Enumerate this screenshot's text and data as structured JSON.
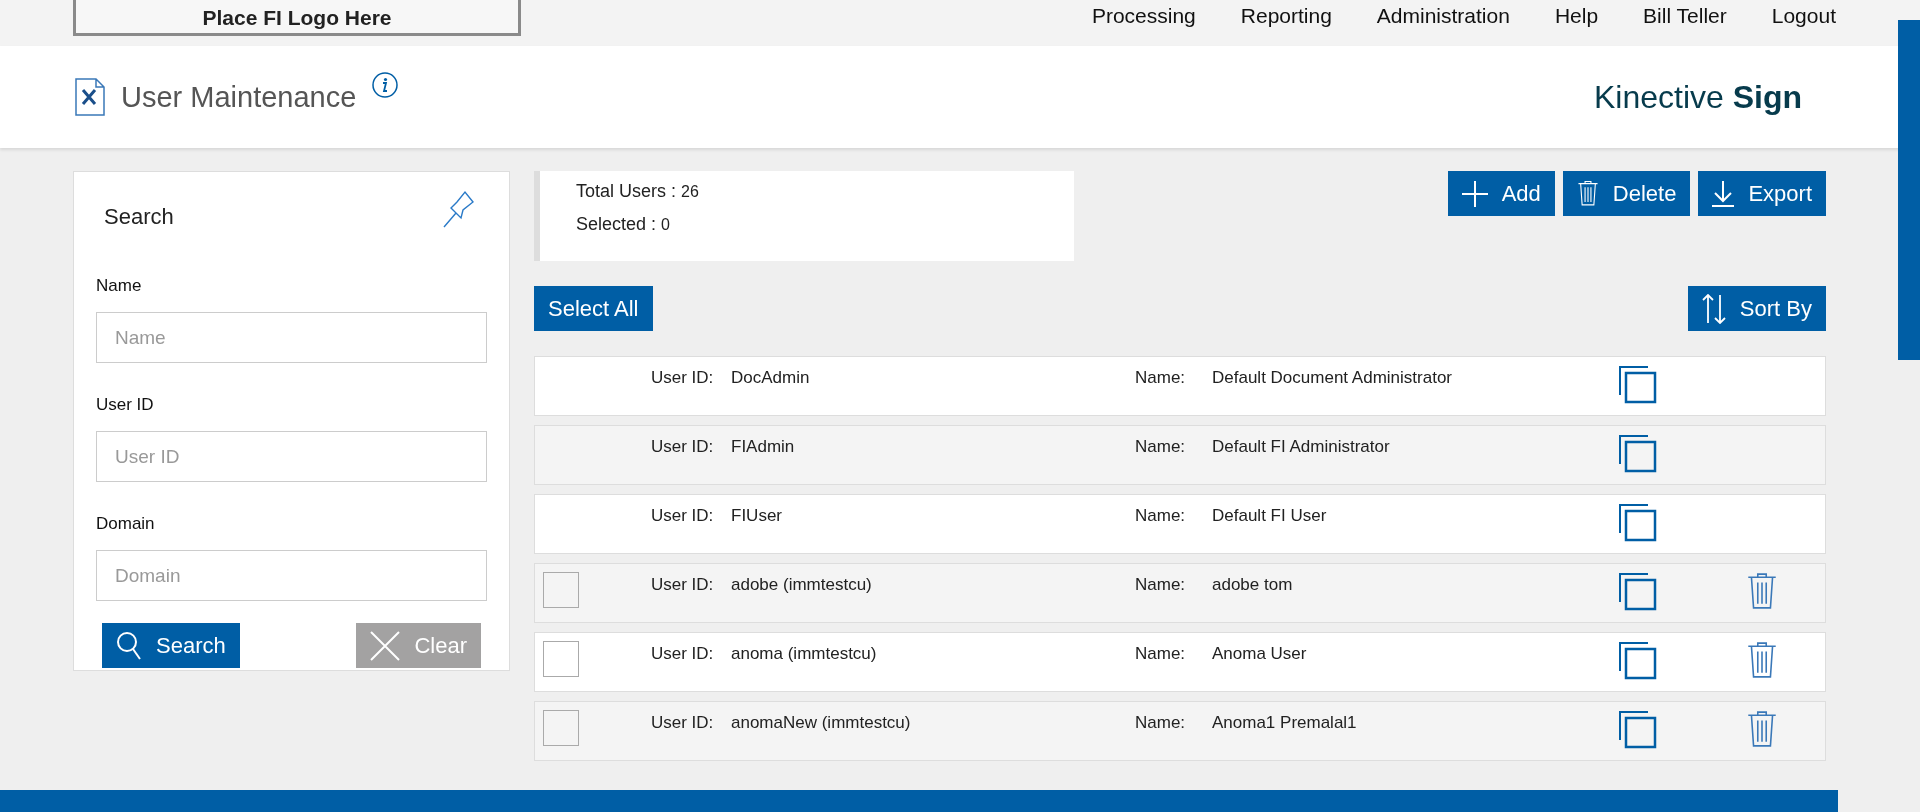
{
  "header": {
    "logo": "Place FI Logo Here",
    "nav": [
      "Processing",
      "Reporting",
      "Administration",
      "Help",
      "Bill Teller",
      "Logout"
    ]
  },
  "page": {
    "title": "User Maintenance",
    "brand": "Kinective **Sign**"
  },
  "search_panel": {
    "title": "Search",
    "fields": [
      {
        "label": "Name",
        "placeholder": "Name"
      },
      {
        "label": "User ID",
        "placeholder": "User ID"
      },
      {
        "label": "Domain",
        "placeholder": "Domain"
      }
    ],
    "buttons": [
      {
        "kind": "search",
        "label": "Search"
      },
      {
        "kind": "clear",
        "label": "Clear"
      }
    ]
  },
  "summary": [
    {
      "label": "Total Users :",
      "value": "26"
    },
    {
      "label": "Selected :",
      "value": "0"
    }
  ],
  "actions": [
    {
      "kind": "add",
      "label": "Add"
    },
    {
      "kind": "delete",
      "label": "Delete"
    },
    {
      "kind": "export",
      "label": "Export"
    }
  ],
  "select_all": "Select All",
  "sort": "Sort By",
  "rows": [
    {
      "kind": "system",
      "user_id_label": "User ID:",
      "user_id": "DocAdmin",
      "name_label": "Name:",
      "name": "Default Document Administrator"
    },
    {
      "kind": "system",
      "user_id_label": "User ID:",
      "user_id": "FIAdmin",
      "name_label": "Name:",
      "name": "Default FI Administrator"
    },
    {
      "kind": "system",
      "user_id_label": "User ID:",
      "user_id": "FIUser",
      "name_label": "Name:",
      "name": "Default FI User"
    },
    {
      "kind": "user",
      "checked": false,
      "user_id_label": "User ID:",
      "user_id": "adobe (immtestcu)",
      "name_label": "Name:",
      "name": "adobe tom"
    },
    {
      "kind": "user",
      "checked": false,
      "user_id_label": "User ID:",
      "user_id": "anoma (immtestcu)",
      "name_label": "Name:",
      "name": "Anoma User"
    },
    {
      "kind": "user",
      "checked": false,
      "user_id_label": "User ID:",
      "user_id": "anomaNew (immtestcu)",
      "name_label": "Name:",
      "name": "Anoma1 Premalal1"
    }
  ]
}
